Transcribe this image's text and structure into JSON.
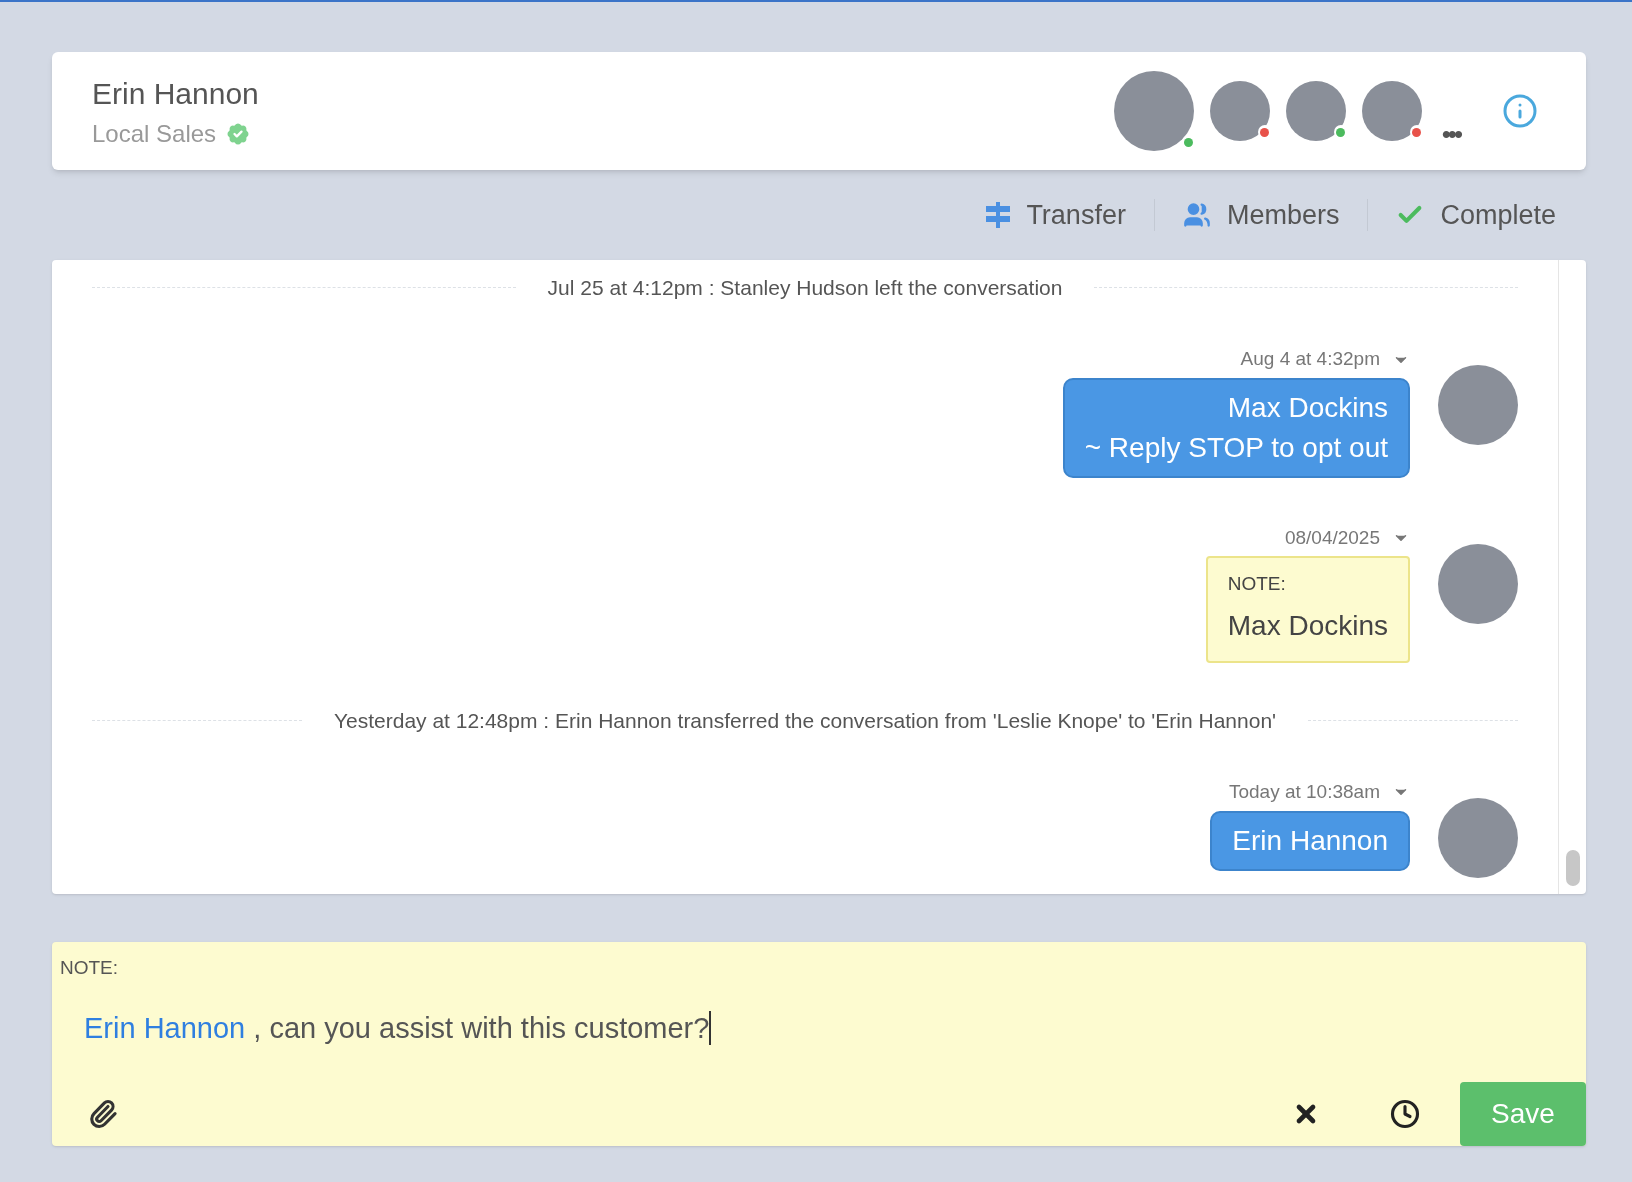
{
  "header": {
    "name": "Erin Hannon",
    "team": "Local Sales",
    "verified": true,
    "members": [
      {
        "color": "#4cbb5e"
      },
      {
        "color": "#e8524a"
      },
      {
        "color": "#4cbb5e"
      },
      {
        "color": "#e8524a"
      }
    ],
    "more": "•••"
  },
  "actions": [
    {
      "kind": "transfer",
      "label": "Transfer"
    },
    {
      "kind": "members",
      "label": "Members"
    },
    {
      "kind": "complete",
      "label": "Complete"
    }
  ],
  "messages": [
    {
      "kind": "system",
      "text": "Jul 25 at 4:12pm : Stanley Hudson left the conversation"
    },
    {
      "kind": "outgoing",
      "time": "Aug 4 at 4:32pm",
      "lines": [
        "Max Dockins",
        "~ Reply STOP to opt out"
      ]
    },
    {
      "kind": "note",
      "time": "08/04/2025",
      "label": "NOTE:",
      "lines": [
        "Max Dockins"
      ]
    },
    {
      "kind": "system",
      "text": "Yesterday at 12:48pm : Erin Hannon transferred the conversation from 'Leslie Knope' to 'Erin Hannon'"
    },
    {
      "kind": "outgoing",
      "time": "Today at 10:38am",
      "lines": [
        "Erin Hannon"
      ]
    }
  ],
  "composer": {
    "label": "NOTE:",
    "mention": "Erin Hannon",
    "text": ", can you assist with this customer?",
    "save": "Save"
  }
}
